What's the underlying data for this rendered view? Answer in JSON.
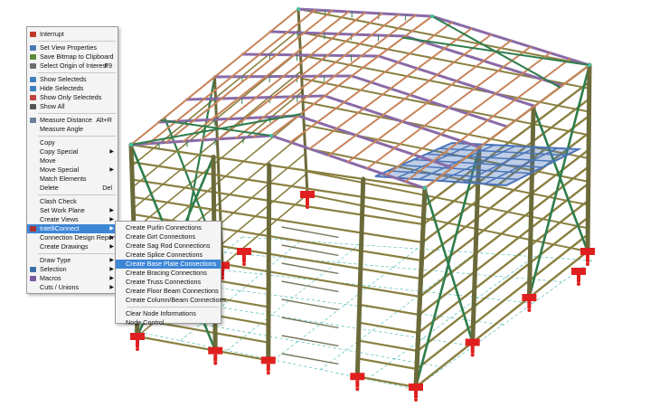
{
  "main_menu": {
    "items": [
      {
        "label": "Interrupt",
        "shortcut": "",
        "submenu": false,
        "icon": "interrupt-icon"
      },
      {
        "sep": true
      },
      {
        "label": "Set View Properties",
        "shortcut": "",
        "submenu": false,
        "icon": "view-properties-icon"
      },
      {
        "label": "Save Bitmap to Clipboard",
        "shortcut": "",
        "submenu": false,
        "icon": "save-bitmap-icon"
      },
      {
        "label": "Select Origin of Interest",
        "shortcut": "F9",
        "submenu": false,
        "icon": "origin-icon"
      },
      {
        "sep": true
      },
      {
        "label": "Show Selecteds",
        "shortcut": "",
        "submenu": false,
        "icon": "show-selected-icon"
      },
      {
        "label": "Hide Selecteds",
        "shortcut": "",
        "submenu": false,
        "icon": "hide-selected-icon"
      },
      {
        "label": "Show Only Selecteds",
        "shortcut": "",
        "submenu": false,
        "icon": "show-only-selected-icon"
      },
      {
        "label": "Show All",
        "shortcut": "",
        "submenu": false,
        "icon": "show-all-icon"
      },
      {
        "sep": true
      },
      {
        "label": "Measure Distance",
        "shortcut": "Alt+R",
        "submenu": false,
        "icon": "measure-distance-icon"
      },
      {
        "label": "Measure Angle",
        "shortcut": "",
        "submenu": false,
        "icon": ""
      },
      {
        "sep": true
      },
      {
        "label": "Copy",
        "shortcut": "",
        "submenu": false,
        "icon": ""
      },
      {
        "label": "Copy Special",
        "shortcut": "",
        "submenu": true,
        "icon": ""
      },
      {
        "label": "Move",
        "shortcut": "",
        "submenu": false,
        "icon": ""
      },
      {
        "label": "Move Special",
        "shortcut": "",
        "submenu": true,
        "icon": ""
      },
      {
        "label": "Match Elements",
        "shortcut": "",
        "submenu": false,
        "icon": ""
      },
      {
        "label": "Delete",
        "shortcut": "Del",
        "submenu": false,
        "icon": ""
      },
      {
        "sep": true
      },
      {
        "label": "Clash Check",
        "shortcut": "",
        "submenu": false,
        "icon": ""
      },
      {
        "label": "Set Work Plane",
        "shortcut": "",
        "submenu": true,
        "icon": ""
      },
      {
        "label": "Create Views",
        "shortcut": "",
        "submenu": true,
        "icon": ""
      },
      {
        "label": "IntelliConnect",
        "shortcut": "",
        "submenu": true,
        "icon": "intelliconnect-icon",
        "highlight": true
      },
      {
        "label": "Connection Design Reports",
        "shortcut": "",
        "submenu": true,
        "icon": ""
      },
      {
        "label": "Create Drawings",
        "shortcut": "",
        "submenu": true,
        "icon": ""
      },
      {
        "sep": true
      },
      {
        "label": "Draw Type",
        "shortcut": "",
        "submenu": true,
        "icon": ""
      },
      {
        "label": "Selection",
        "shortcut": "",
        "submenu": true,
        "icon": "selection-icon"
      },
      {
        "label": "Macros",
        "shortcut": "",
        "submenu": true,
        "icon": "macros-icon"
      },
      {
        "label": "Cuts / Unions",
        "shortcut": "",
        "submenu": true,
        "icon": ""
      }
    ]
  },
  "sub_menu": {
    "items": [
      {
        "label": "Create Purlin Connections"
      },
      {
        "label": "Create Girt Connections"
      },
      {
        "label": "Create Sag Rod Connections"
      },
      {
        "label": "Create Splice Connections"
      },
      {
        "label": "Create Base Plate Connections",
        "highlight": true
      },
      {
        "label": "Create Bracing Connections"
      },
      {
        "label": "Create Truss Connections"
      },
      {
        "label": "Create Floor Beam Connections"
      },
      {
        "label": "Create Column/Beam Connections"
      },
      {
        "sep": true
      },
      {
        "label": "Clear Node Informations"
      },
      {
        "label": "Node Control"
      }
    ]
  },
  "colors": {
    "menu_bg": "#f4f4f4",
    "highlight": "#3d86d6",
    "column": "#6b6a3a",
    "girt": "#8a8040",
    "purlin": "#c8845a",
    "rafter": "#8a6aa6",
    "bracing": "#2f7d4c",
    "node": "#e02020",
    "floor": "#4a74b8",
    "grid_line": "#3fb7b0"
  }
}
